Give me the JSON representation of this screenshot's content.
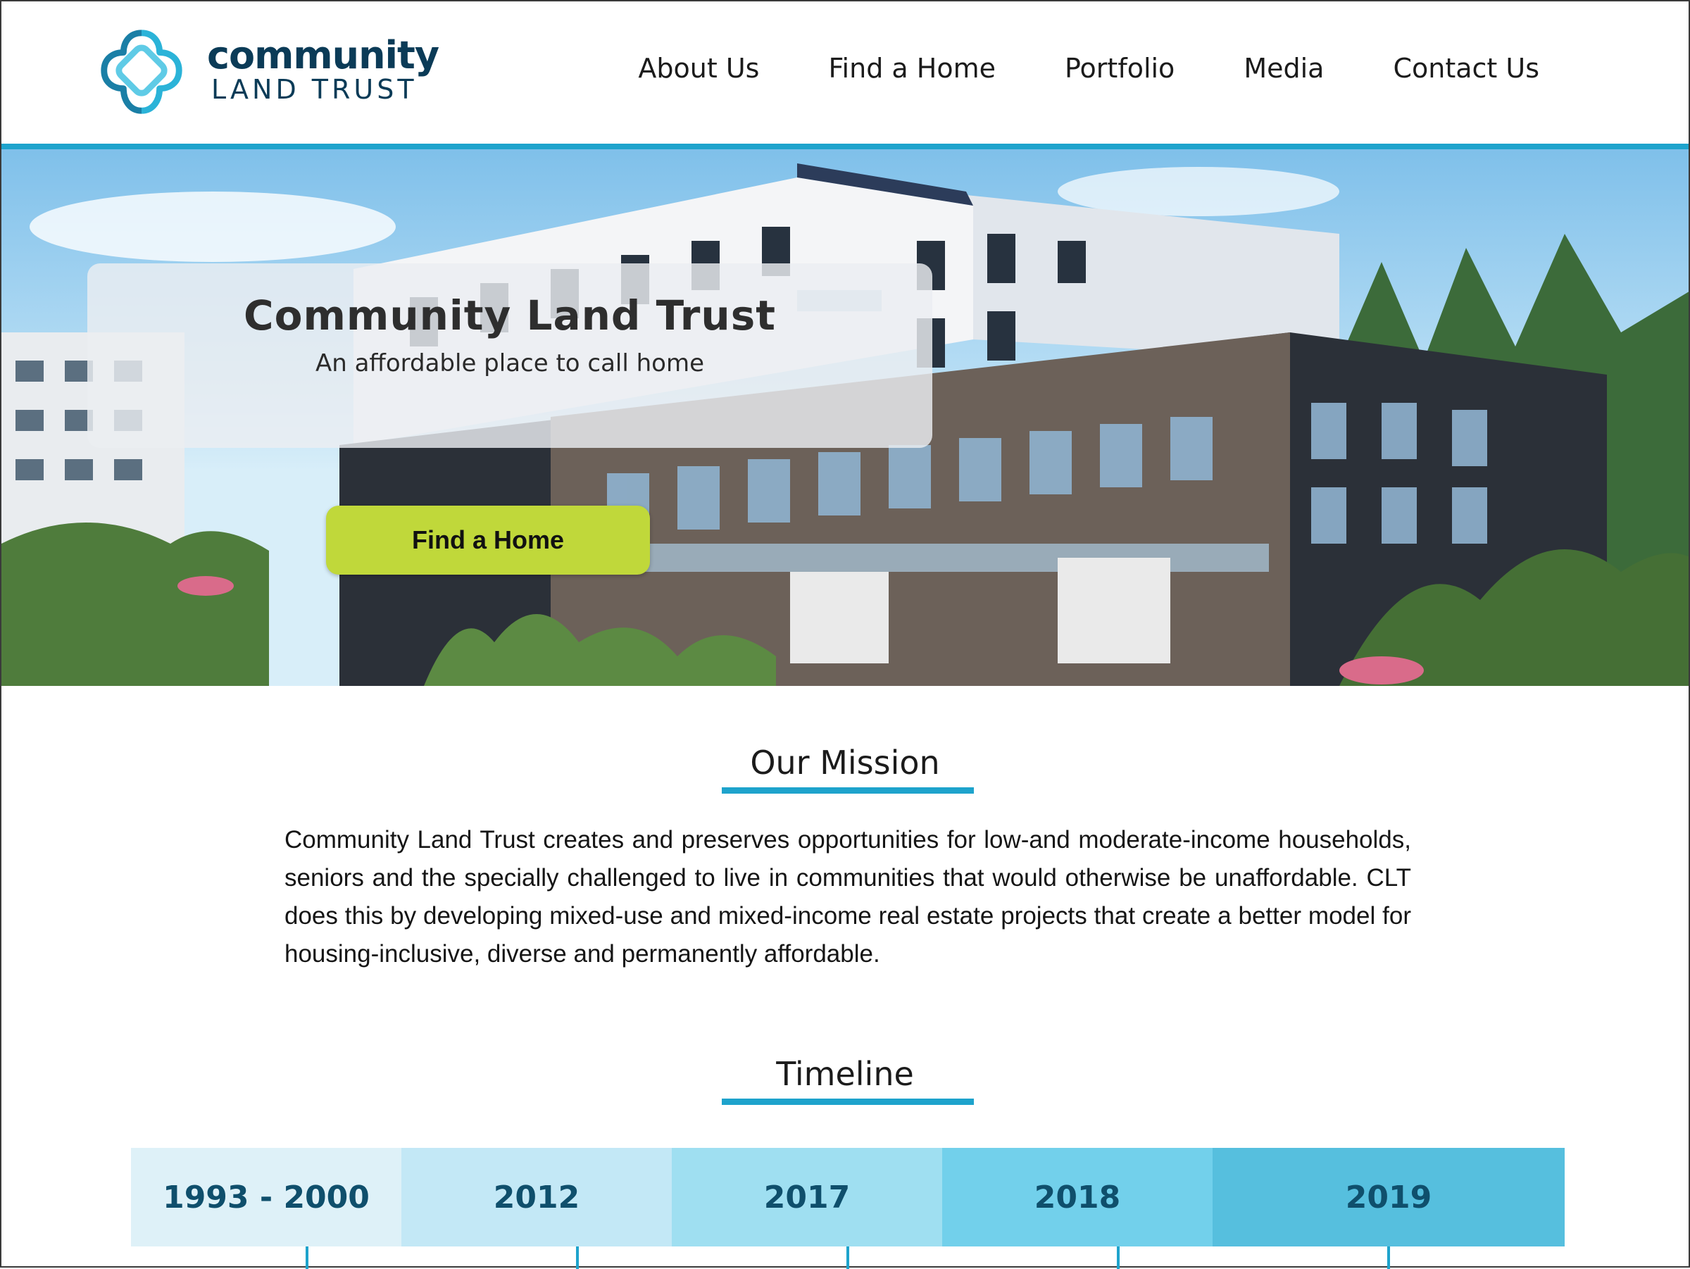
{
  "header": {
    "logo": {
      "line1": "community",
      "line2": "LAND TRUST"
    },
    "nav": [
      "About Us",
      "Find a Home",
      "Portfolio",
      "Media",
      "Contact Us"
    ]
  },
  "hero": {
    "title": "Community Land Trust",
    "subtitle": "An affordable place to call home",
    "cta_label": "Find a Home"
  },
  "mission": {
    "heading": "Our Mission",
    "text": "Community Land Trust creates and preserves opportunities for low-and moderate-income households, seniors and the specially challenged to live in communities that would otherwise be unaffordable. CLT does this by developing mixed-use and mixed-income real estate projects that create a better model for housing-inclusive, diverse and permanently affordable."
  },
  "timeline": {
    "heading": "Timeline",
    "segments": [
      {
        "label": "1993 - 2000",
        "color": "#def1f8"
      },
      {
        "label": "2012",
        "color": "#c3e8f6"
      },
      {
        "label": "2017",
        "color": "#9fdff1"
      },
      {
        "label": "2018",
        "color": "#72d0eb"
      },
      {
        "label": "2019",
        "color": "#56bfde"
      }
    ]
  },
  "colors": {
    "accent": "#1ea3cc",
    "cta": "#c0d83a",
    "brand_dark": "#0b3b57"
  }
}
